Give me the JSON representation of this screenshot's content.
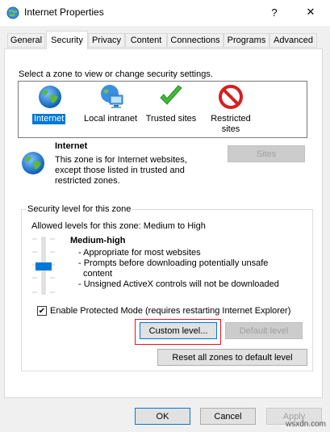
{
  "window": {
    "title": "Internet Properties",
    "help_glyph": "?",
    "close_glyph": "✕"
  },
  "tabs": [
    {
      "label": "General",
      "active": false
    },
    {
      "label": "Security",
      "active": true
    },
    {
      "label": "Privacy",
      "active": false
    },
    {
      "label": "Content",
      "active": false
    },
    {
      "label": "Connections",
      "active": false
    },
    {
      "label": "Programs",
      "active": false
    },
    {
      "label": "Advanced",
      "active": false
    }
  ],
  "security": {
    "zone_prompt": "Select a zone to view or change security settings.",
    "zones": [
      {
        "label": "Internet",
        "icon": "globe-icon",
        "selected": true
      },
      {
        "label": "Local intranet",
        "icon": "network-computer-icon",
        "selected": false
      },
      {
        "label": "Trusted sites",
        "icon": "checkmark-icon",
        "selected": false
      },
      {
        "label_line1": "Restricted",
        "label_line2": "sites",
        "icon": "prohibited-icon",
        "selected": false
      }
    ],
    "zone_info": {
      "title": "Internet",
      "desc_line1": "This zone is for Internet websites,",
      "desc_line2": "except those listed in trusted and",
      "desc_line3": "restricted zones.",
      "sites_button": "Sites"
    },
    "level_group": {
      "title": "Security level for this zone",
      "allowed": "Allowed levels for this zone: Medium to High",
      "level_name": "Medium-high",
      "bullets": [
        "- Appropriate for most websites",
        "- Prompts before downloading potentially unsafe",
        "  content",
        "- Unsigned ActiveX controls will not be downloaded"
      ],
      "slider_level": "Medium-high",
      "protected_mode_label": "Enable Protected Mode (requires restarting Internet Explorer)",
      "protected_mode_checked": true,
      "protected_mode_check_glyph": "✔",
      "custom_level_button": "Custom level...",
      "default_level_button": "Default level"
    },
    "reset_all_button": "Reset all zones to default level"
  },
  "footer": {
    "ok": "OK",
    "cancel": "Cancel",
    "apply": "Apply"
  },
  "watermark": "wsxdn.com",
  "colors": {
    "accent": "#0078d7",
    "highlight_box": "#e81123"
  }
}
